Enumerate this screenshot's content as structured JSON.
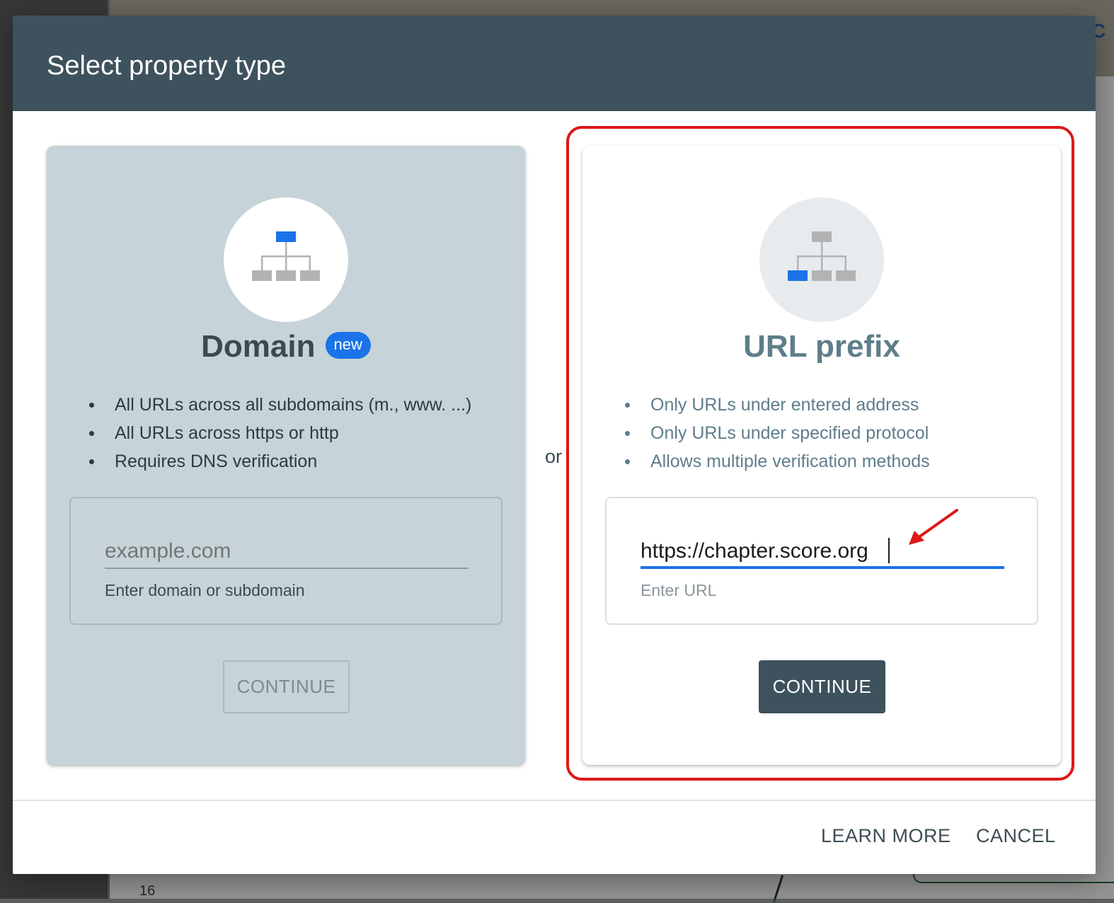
{
  "dialog": {
    "title": "Select property type",
    "or_label": "or"
  },
  "domain_card": {
    "title": "Domain",
    "badge": "new",
    "features": [
      "All URLs across all subdomains (m., www. ...)",
      "All URLs across https or http",
      "Requires DNS verification"
    ],
    "input_placeholder": "example.com",
    "input_value": "",
    "input_hint": "Enter domain or subdomain",
    "button_label": "CONTINUE",
    "icon": "sitemap-icon-top-highlight"
  },
  "url_card": {
    "title": "URL prefix",
    "features": [
      "Only URLs under entered address",
      "Only URLs under specified protocol",
      "Allows multiple verification methods"
    ],
    "input_value": "https://chapter.score.org",
    "input_hint": "Enter URL",
    "button_label": "CONTINUE",
    "icon": "sitemap-icon-bottom-left-highlight"
  },
  "footer": {
    "learn_more_label": "LEARN MORE",
    "cancel_label": "CANCEL"
  },
  "background": {
    "peek_text": "C",
    "peek_number": "16"
  },
  "colors": {
    "header": "#3d525c",
    "accent_blue": "#1a73e8",
    "annotation_red": "#dd1818",
    "domain_card_bg": "#c6d3d8"
  }
}
